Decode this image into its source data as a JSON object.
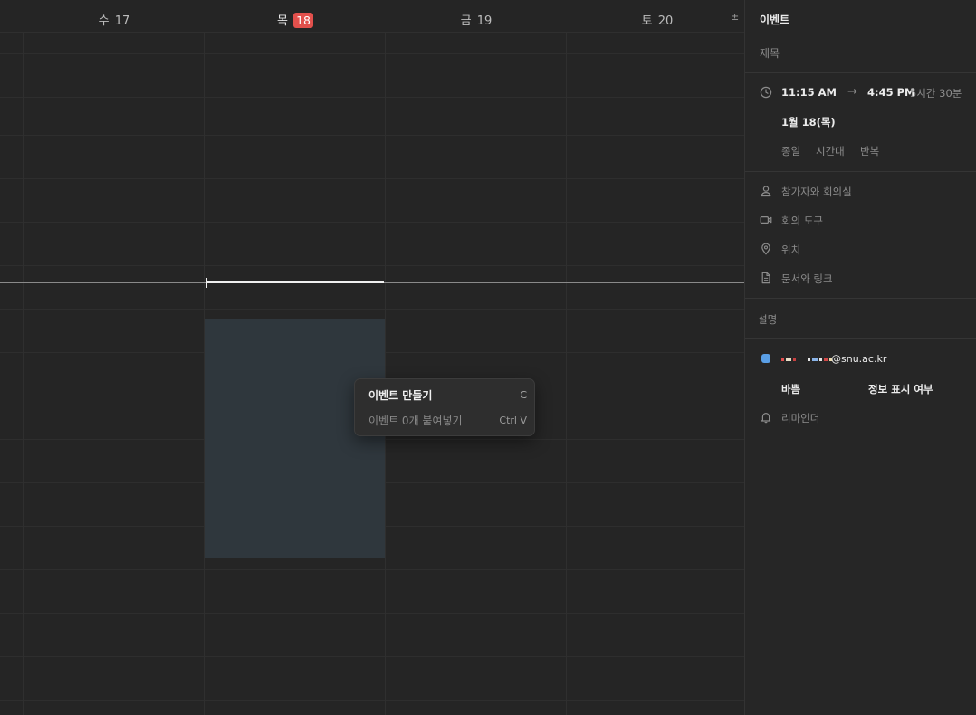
{
  "calendar": {
    "days": [
      {
        "weekday": "수",
        "date": "17",
        "today": false
      },
      {
        "weekday": "목",
        "date": "18",
        "today": true
      },
      {
        "weekday": "금",
        "date": "19",
        "today": false
      },
      {
        "weekday": "토",
        "date": "20",
        "today": false
      }
    ],
    "collapse_symbol": "±"
  },
  "context_menu": {
    "items": [
      {
        "label": "이벤트 만들기",
        "shortcut": "C",
        "enabled": true
      },
      {
        "label": "이벤트 0개 붙여넣기",
        "shortcut": "Ctrl V",
        "enabled": false
      }
    ]
  },
  "panel": {
    "header": "이벤트",
    "title_placeholder": "제목",
    "start_time": "11:15 AM",
    "arrow": "→",
    "end_time": "4:45 PM",
    "duration": "5시간 30분",
    "date": "1월 18(목)",
    "options": [
      "종일",
      "시간대",
      "반복"
    ],
    "rows": [
      {
        "icon": "person-icon",
        "label": "참가자와 회의실"
      },
      {
        "icon": "video-icon",
        "label": "회의 도구"
      },
      {
        "icon": "location-pin-icon",
        "label": "위치"
      },
      {
        "icon": "document-icon",
        "label": "문서와 링크"
      }
    ],
    "description_placeholder": "설명",
    "calendar_email_suffix": "@snu.ac.kr",
    "availability": "바쁨",
    "visibility": "정보 표시 여부",
    "reminder": "리마인더"
  },
  "colors": {
    "today_badge": "#e2504c",
    "selection": "#2f373d",
    "calendar_dot": "#5a9fe6"
  }
}
